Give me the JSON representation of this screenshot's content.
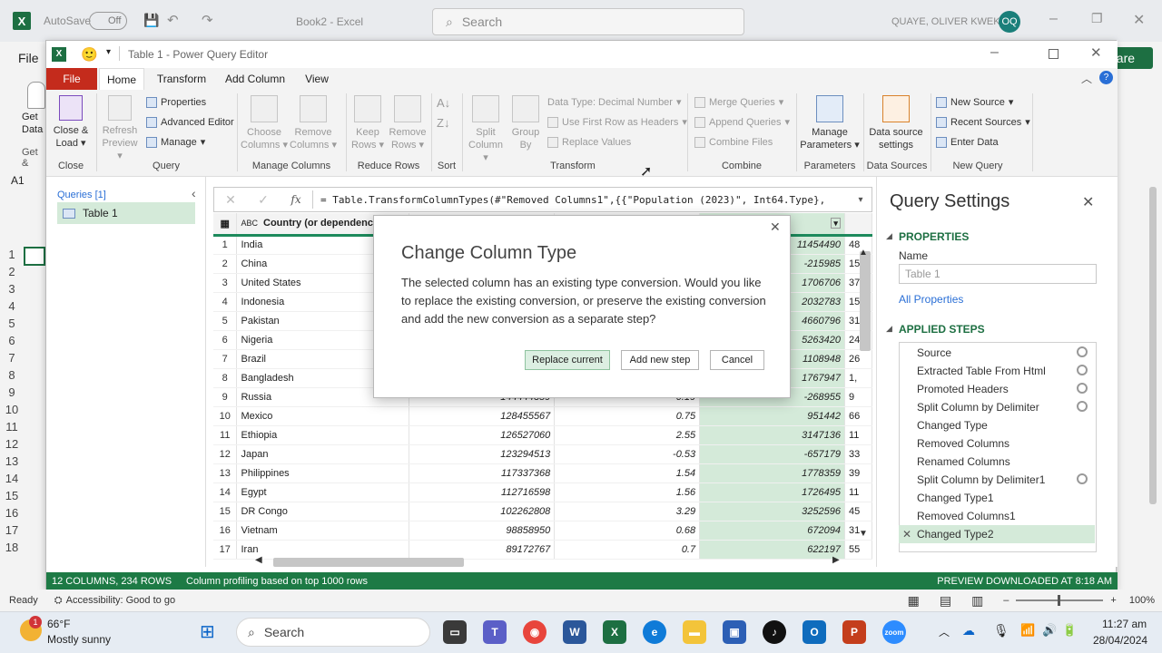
{
  "excel": {
    "autosave_label": "AutoSave",
    "autosave_state": "Off",
    "book_title": "Book2",
    "app_name": "Excel",
    "search_placeholder": "Search",
    "user_name": "QUAYE, OLIVER KWEKU",
    "user_initials": "OQ",
    "file_label": "File",
    "share_label": "hare",
    "get_data_label": "Get Data",
    "get_label": "Get &",
    "name_box": "A1",
    "row_numbers": [
      "1",
      "2",
      "3",
      "4",
      "5",
      "6",
      "7",
      "8",
      "9",
      "10",
      "11",
      "12",
      "13",
      "14",
      "15",
      "16",
      "17",
      "18"
    ],
    "status_ready": "Ready",
    "accessibility": "Accessibility: Good to go",
    "zoom": "100%"
  },
  "pq": {
    "title": "Table 1 - Power Query Editor",
    "tabs": [
      "File",
      "Home",
      "Transform",
      "Add Column",
      "View"
    ],
    "ribbon": {
      "close_load": "Close & Load",
      "refresh_preview": "Refresh Preview",
      "properties": "Properties",
      "advanced_editor": "Advanced Editor",
      "manage": "Manage",
      "choose_columns": "Choose Columns",
      "remove_columns": "Remove Columns",
      "keep_rows": "Keep Rows",
      "remove_rows": "Remove Rows",
      "split_column": "Split Column",
      "group_by": "Group By",
      "data_type": "Data Type: Decimal Number",
      "use_first_row": "Use First Row as Headers",
      "replace_values": "Replace Values",
      "merge_queries": "Merge Queries",
      "append_queries": "Append Queries",
      "combine_files": "Combine Files",
      "manage_parameters": "Manage Parameters",
      "data_source_settings": "Data source settings",
      "new_source": "New Source",
      "recent_sources": "Recent Sources",
      "enter_data": "Enter Data",
      "groups": {
        "close": "Close",
        "query": "Query",
        "manage_columns": "Manage Columns",
        "reduce_rows": "Reduce Rows",
        "sort": "Sort",
        "transform": "Transform",
        "combine": "Combine",
        "parameters": "Parameters",
        "data_sources": "Data Sources",
        "new_query": "New Query"
      }
    },
    "queries_header": "Queries [1]",
    "query_item": "Table 1",
    "formula": "= Table.TransformColumnTypes(#\"Removed Columns1\",{{\"Population (2023)\", Int64.Type},",
    "fx": "fx",
    "column_header": "Country (or dependency)",
    "column_type_icon": "ABC",
    "rows": [
      {
        "idx": "1",
        "country": "India",
        "pop": "",
        "chg": "",
        "net": "11454490",
        "extra": "48"
      },
      {
        "idx": "2",
        "country": "China",
        "pop": "",
        "chg": "",
        "net": "-215985",
        "extra": "15"
      },
      {
        "idx": "3",
        "country": "United States",
        "pop": "",
        "chg": "",
        "net": "1706706",
        "extra": "37"
      },
      {
        "idx": "4",
        "country": "Indonesia",
        "pop": "",
        "chg": "",
        "net": "2032783",
        "extra": "15"
      },
      {
        "idx": "5",
        "country": "Pakistan",
        "pop": "",
        "chg": "",
        "net": "4660796",
        "extra": "31"
      },
      {
        "idx": "6",
        "country": "Nigeria",
        "pop": "",
        "chg": "",
        "net": "5263420",
        "extra": "24"
      },
      {
        "idx": "7",
        "country": "Brazil",
        "pop": "",
        "chg": "",
        "net": "1108948",
        "extra": "26"
      },
      {
        "idx": "8",
        "country": "Bangladesh",
        "pop": "",
        "chg": "",
        "net": "1767947",
        "extra": "1,"
      },
      {
        "idx": "9",
        "country": "Russia",
        "pop": "144444359",
        "chg": "-0.19",
        "net": "-268955",
        "extra": "9"
      },
      {
        "idx": "10",
        "country": "Mexico",
        "pop": "128455567",
        "chg": "0.75",
        "net": "951442",
        "extra": "66"
      },
      {
        "idx": "11",
        "country": "Ethiopia",
        "pop": "126527060",
        "chg": "2.55",
        "net": "3147136",
        "extra": "11"
      },
      {
        "idx": "12",
        "country": "Japan",
        "pop": "123294513",
        "chg": "-0.53",
        "net": "-657179",
        "extra": "33"
      },
      {
        "idx": "13",
        "country": "Philippines",
        "pop": "117337368",
        "chg": "1.54",
        "net": "1778359",
        "extra": "39"
      },
      {
        "idx": "14",
        "country": "Egypt",
        "pop": "112716598",
        "chg": "1.56",
        "net": "1726495",
        "extra": "11"
      },
      {
        "idx": "15",
        "country": "DR Congo",
        "pop": "102262808",
        "chg": "3.29",
        "net": "3252596",
        "extra": "45"
      },
      {
        "idx": "16",
        "country": "Vietnam",
        "pop": "98858950",
        "chg": "0.68",
        "net": "672094",
        "extra": "31"
      },
      {
        "idx": "17",
        "country": "Iran",
        "pop": "89172767",
        "chg": "0.7",
        "net": "622197",
        "extra": "55"
      }
    ],
    "status_left": "12 COLUMNS, 234 ROWS",
    "status_profiling": "Column profiling based on top 1000 rows",
    "status_right": "PREVIEW DOWNLOADED AT 8:18 AM"
  },
  "dialog": {
    "title": "Change Column Type",
    "message": "The selected column has an existing type conversion. Would you like to replace the existing conversion, or preserve the existing conversion and add the new conversion as a separate step?",
    "replace": "Replace current",
    "add_step": "Add new step",
    "cancel": "Cancel"
  },
  "settings": {
    "title": "Query Settings",
    "properties_header": "PROPERTIES",
    "name_label": "Name",
    "name_value": "Table 1",
    "all_properties": "All Properties",
    "applied_steps_header": "APPLIED STEPS",
    "steps": [
      {
        "label": "Source",
        "gear": true
      },
      {
        "label": "Extracted Table From Html",
        "gear": true
      },
      {
        "label": "Promoted Headers",
        "gear": true
      },
      {
        "label": "Split Column by Delimiter",
        "gear": true
      },
      {
        "label": "Changed Type",
        "gear": false
      },
      {
        "label": "Removed Columns",
        "gear": false
      },
      {
        "label": "Renamed Columns",
        "gear": false
      },
      {
        "label": "Split Column by Delimiter1",
        "gear": true
      },
      {
        "label": "Changed Type1",
        "gear": false
      },
      {
        "label": "Removed Columns1",
        "gear": false
      },
      {
        "label": "Changed Type2",
        "gear": false
      }
    ]
  },
  "taskbar": {
    "weather_temp": "66°F",
    "weather_desc": "Mostly sunny",
    "search": "Search",
    "time": "11:27 am",
    "date": "28/04/2024",
    "badge": "1"
  },
  "colors": {
    "excel_green": "#1d6f42",
    "status_green": "#1d7a45",
    "file_tab": "#c42b1c",
    "selected": "#d4ead9"
  }
}
